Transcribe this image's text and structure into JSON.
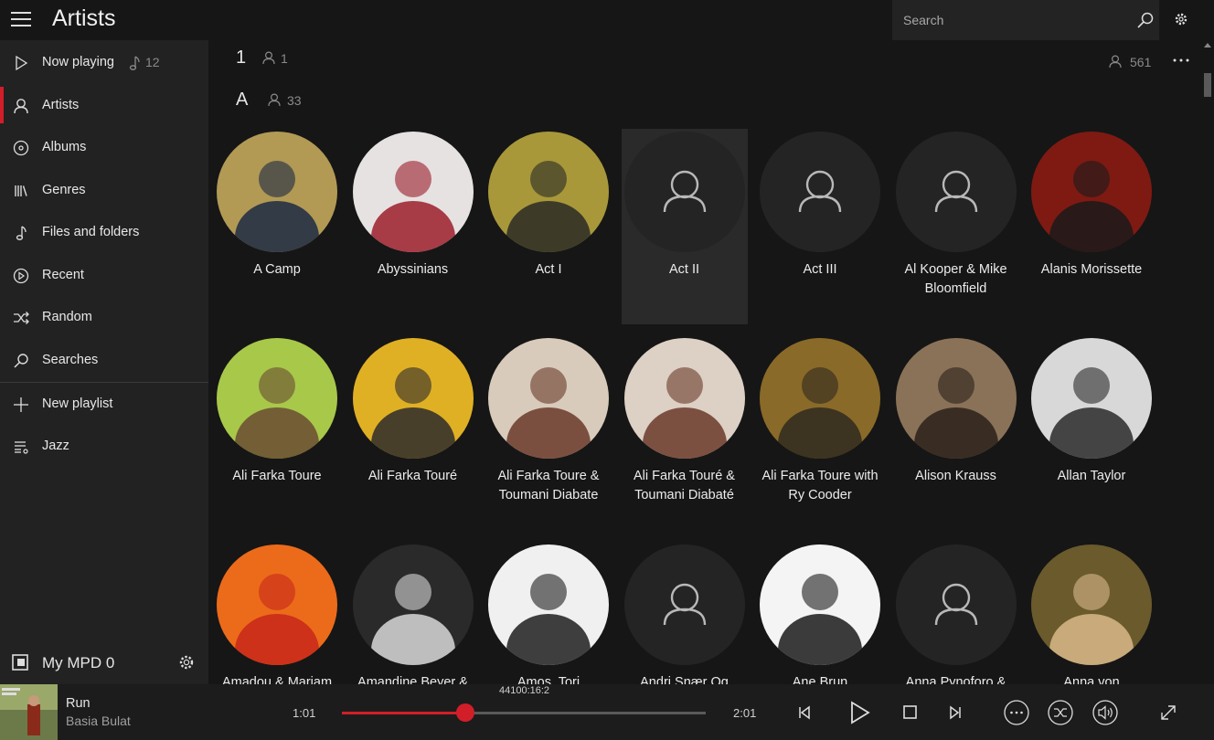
{
  "header": {
    "title": "Artists",
    "search_placeholder": "Search"
  },
  "sidebar": {
    "items": [
      {
        "label": "Now playing",
        "count": "12",
        "icon": "play-icon"
      },
      {
        "label": "Artists",
        "icon": "person-icon"
      },
      {
        "label": "Albums",
        "icon": "disc-icon"
      },
      {
        "label": "Genres",
        "icon": "library-icon"
      },
      {
        "label": "Files and folders",
        "icon": "music-note-icon"
      },
      {
        "label": "Recent",
        "icon": "recent-icon"
      },
      {
        "label": "Random",
        "icon": "shuffle-icon"
      },
      {
        "label": "Searches",
        "icon": "search-icon"
      },
      {
        "label": "New playlist",
        "icon": "plus-icon"
      },
      {
        "label": "Jazz",
        "icon": "playlist-icon"
      }
    ],
    "server": "My MPD 0"
  },
  "main": {
    "total_artists": "561",
    "groups": [
      {
        "letter": "1",
        "count": "1"
      },
      {
        "letter": "A",
        "count": "33"
      }
    ],
    "artists": [
      {
        "name": "A Camp",
        "art": "photo",
        "colors": [
          "#b29a55",
          "#1c2a44"
        ]
      },
      {
        "name": "Abyssinians",
        "art": "photo",
        "colors": [
          "#e6e2e2",
          "#9b1d2a"
        ]
      },
      {
        "name": "Act I",
        "art": "photo",
        "colors": [
          "#a8983a",
          "#2a2a26"
        ]
      },
      {
        "name": "Act II",
        "art": "placeholder",
        "colors": [],
        "selected": true
      },
      {
        "name": "Act III",
        "art": "placeholder",
        "colors": []
      },
      {
        "name": "Al Kooper & Mike Bloomfield",
        "art": "placeholder",
        "colors": []
      },
      {
        "name": "Alanis Morissette",
        "art": "photo",
        "colors": [
          "#7e1a12",
          "#1a1a1a"
        ]
      },
      {
        "name": "Ali Farka Toure",
        "art": "photo",
        "colors": [
          "#a8c84a",
          "#6a4b33"
        ]
      },
      {
        "name": "Ali Farka Touré",
        "art": "photo",
        "colors": [
          "#e0b024",
          "#2c2c2c"
        ]
      },
      {
        "name": "Ali Farka Toure & Toumani Diabate",
        "art": "photo",
        "colors": [
          "#d8cbbb",
          "#6b3a2a"
        ]
      },
      {
        "name": "Ali Farka Touré & Toumani Diabaté",
        "art": "photo",
        "colors": [
          "#ddd0c4",
          "#6b3a2a"
        ]
      },
      {
        "name": "Ali Farka Toure with Ry Cooder",
        "art": "photo",
        "colors": [
          "#8a6a28",
          "#2e2a1e"
        ]
      },
      {
        "name": "Alison Krauss",
        "art": "photo",
        "colors": [
          "#8a7258",
          "#2a211a"
        ]
      },
      {
        "name": "Allan Taylor",
        "art": "photo",
        "colors": [
          "#d8d8d8",
          "#2a2a2a"
        ]
      },
      {
        "name": "Amadou & Mariam",
        "art": "photo",
        "colors": [
          "#ec6b1a",
          "#c8271a"
        ]
      },
      {
        "name": "Amandine Beyer &",
        "art": "photo",
        "colors": [
          "#2a2a2a",
          "#d8d8d8"
        ]
      },
      {
        "name": "Amos, Tori",
        "art": "photo",
        "colors": [
          "#f0f0f0",
          "#1e1e1e"
        ]
      },
      {
        "name": "Andri Snær Og",
        "art": "placeholder",
        "colors": []
      },
      {
        "name": "Ane Brun",
        "art": "photo",
        "colors": [
          "#f4f4f4",
          "#1a1a1a"
        ]
      },
      {
        "name": "Anna Pynoforo &",
        "art": "placeholder",
        "colors": []
      },
      {
        "name": "Anna von",
        "art": "photo",
        "colors": [
          "#6a5a2c",
          "#d8b88a"
        ]
      }
    ]
  },
  "player": {
    "title": "Run",
    "artist": "Basia Bulat",
    "elapsed": "1:01",
    "remaining": "2:01",
    "format": "44100:16:2",
    "progress": 0.34
  },
  "colors": {
    "accent": "#d21e28"
  }
}
